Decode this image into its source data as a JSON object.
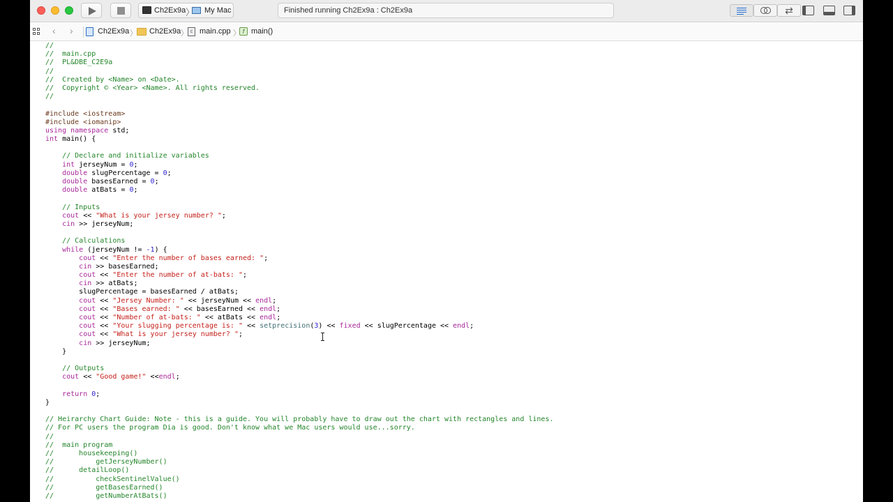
{
  "toolbar": {
    "scheme_target": "Ch2Ex9a",
    "scheme_device": "My Mac",
    "status_text": "Finished running Ch2Ex9a : Ch2Ex9a"
  },
  "jumpbar": {
    "project": "Ch2Ex9a",
    "folder": "Ch2Ex9a",
    "file": "main.cpp",
    "function": "main()",
    "function_icon_glyph": "f",
    "file_icon_glyph": "c"
  },
  "editor": {
    "lines": [
      {
        "segments": [
          {
            "t": "//",
            "c": "cm"
          }
        ]
      },
      {
        "segments": [
          {
            "t": "//  main.cpp",
            "c": "cm"
          }
        ]
      },
      {
        "segments": [
          {
            "t": "//  PL&DBE_C2E9a",
            "c": "cm"
          }
        ]
      },
      {
        "segments": [
          {
            "t": "//",
            "c": "cm"
          }
        ]
      },
      {
        "segments": [
          {
            "t": "//  Created by <Name> on <Date>.",
            "c": "cm"
          }
        ]
      },
      {
        "segments": [
          {
            "t": "//  Copyright © <Year> <Name>. All rights reserved.",
            "c": "cm"
          }
        ]
      },
      {
        "segments": [
          {
            "t": "//",
            "c": "cm"
          }
        ]
      },
      {
        "segments": []
      },
      {
        "segments": [
          {
            "t": "#include <iostream>",
            "c": "pp"
          }
        ]
      },
      {
        "segments": [
          {
            "t": "#include <iomanip>",
            "c": "pp"
          }
        ]
      },
      {
        "segments": [
          {
            "t": "using namespace",
            "c": "kw"
          },
          {
            "t": " std;",
            "c": ""
          }
        ]
      },
      {
        "segments": [
          {
            "t": "int",
            "c": "kw"
          },
          {
            "t": " main() {",
            "c": ""
          }
        ]
      },
      {
        "segments": []
      },
      {
        "segments": [
          {
            "t": "    // Declare and initialize variables",
            "c": "cm"
          }
        ]
      },
      {
        "segments": [
          {
            "t": "    ",
            "c": ""
          },
          {
            "t": "int",
            "c": "kw"
          },
          {
            "t": " jerseyNum = ",
            "c": ""
          },
          {
            "t": "0",
            "c": "nm"
          },
          {
            "t": ";",
            "c": ""
          }
        ]
      },
      {
        "segments": [
          {
            "t": "    ",
            "c": ""
          },
          {
            "t": "double",
            "c": "kw"
          },
          {
            "t": " slugPercentage = ",
            "c": ""
          },
          {
            "t": "0",
            "c": "nm"
          },
          {
            "t": ";",
            "c": ""
          }
        ]
      },
      {
        "segments": [
          {
            "t": "    ",
            "c": ""
          },
          {
            "t": "double",
            "c": "kw"
          },
          {
            "t": " basesEarned = ",
            "c": ""
          },
          {
            "t": "0",
            "c": "nm"
          },
          {
            "t": ";",
            "c": ""
          }
        ]
      },
      {
        "segments": [
          {
            "t": "    ",
            "c": ""
          },
          {
            "t": "double",
            "c": "kw"
          },
          {
            "t": " atBats = ",
            "c": ""
          },
          {
            "t": "0",
            "c": "nm"
          },
          {
            "t": ";",
            "c": ""
          }
        ]
      },
      {
        "segments": []
      },
      {
        "segments": [
          {
            "t": "    // Inputs",
            "c": "cm"
          }
        ]
      },
      {
        "segments": [
          {
            "t": "    ",
            "c": ""
          },
          {
            "t": "cout",
            "c": "kw"
          },
          {
            "t": " << ",
            "c": ""
          },
          {
            "t": "\"What is your jersey number? \"",
            "c": "st"
          },
          {
            "t": ";",
            "c": ""
          }
        ]
      },
      {
        "segments": [
          {
            "t": "    ",
            "c": ""
          },
          {
            "t": "cin",
            "c": "kw"
          },
          {
            "t": " >> jerseyNum;",
            "c": ""
          }
        ]
      },
      {
        "segments": []
      },
      {
        "segments": [
          {
            "t": "    // Calculations",
            "c": "cm"
          }
        ]
      },
      {
        "segments": [
          {
            "t": "    ",
            "c": ""
          },
          {
            "t": "while",
            "c": "kw"
          },
          {
            "t": " (jerseyNum != ",
            "c": ""
          },
          {
            "t": "-1",
            "c": "nm"
          },
          {
            "t": ") {",
            "c": ""
          }
        ]
      },
      {
        "segments": [
          {
            "t": "        ",
            "c": ""
          },
          {
            "t": "cout",
            "c": "kw"
          },
          {
            "t": " << ",
            "c": ""
          },
          {
            "t": "\"Enter the number of bases earned: \"",
            "c": "st"
          },
          {
            "t": ";",
            "c": ""
          }
        ]
      },
      {
        "segments": [
          {
            "t": "        ",
            "c": ""
          },
          {
            "t": "cin",
            "c": "kw"
          },
          {
            "t": " >> basesEarned;",
            "c": ""
          }
        ]
      },
      {
        "segments": [
          {
            "t": "        ",
            "c": ""
          },
          {
            "t": "cout",
            "c": "kw"
          },
          {
            "t": " << ",
            "c": ""
          },
          {
            "t": "\"Enter the number of at-bats: \"",
            "c": "st"
          },
          {
            "t": ";",
            "c": ""
          }
        ]
      },
      {
        "segments": [
          {
            "t": "        ",
            "c": ""
          },
          {
            "t": "cin",
            "c": "kw"
          },
          {
            "t": " >> atBats;",
            "c": ""
          }
        ]
      },
      {
        "segments": [
          {
            "t": "        slugPercentage = basesEarned / atBats;",
            "c": ""
          }
        ]
      },
      {
        "segments": [
          {
            "t": "        ",
            "c": ""
          },
          {
            "t": "cout",
            "c": "kw"
          },
          {
            "t": " << ",
            "c": ""
          },
          {
            "t": "\"Jersey Number: \"",
            "c": "st"
          },
          {
            "t": " << jerseyNum << ",
            "c": ""
          },
          {
            "t": "endl",
            "c": "kw"
          },
          {
            "t": ";",
            "c": ""
          }
        ]
      },
      {
        "segments": [
          {
            "t": "        ",
            "c": ""
          },
          {
            "t": "cout",
            "c": "kw"
          },
          {
            "t": " << ",
            "c": ""
          },
          {
            "t": "\"Bases earned: \"",
            "c": "st"
          },
          {
            "t": " << basesEarned << ",
            "c": ""
          },
          {
            "t": "endl",
            "c": "kw"
          },
          {
            "t": ";",
            "c": ""
          }
        ]
      },
      {
        "segments": [
          {
            "t": "        ",
            "c": ""
          },
          {
            "t": "cout",
            "c": "kw"
          },
          {
            "t": " << ",
            "c": ""
          },
          {
            "t": "\"Number of at-bats: \"",
            "c": "st"
          },
          {
            "t": " << atBats << ",
            "c": ""
          },
          {
            "t": "endl",
            "c": "kw"
          },
          {
            "t": ";",
            "c": ""
          }
        ]
      },
      {
        "segments": [
          {
            "t": "        ",
            "c": ""
          },
          {
            "t": "cout",
            "c": "kw"
          },
          {
            "t": " << ",
            "c": ""
          },
          {
            "t": "\"Your slugging percentage is: \"",
            "c": "st"
          },
          {
            "t": " << ",
            "c": ""
          },
          {
            "t": "setprecision",
            "c": "fn"
          },
          {
            "t": "(",
            "c": ""
          },
          {
            "t": "3",
            "c": "nm"
          },
          {
            "t": ") << ",
            "c": ""
          },
          {
            "t": "fixed",
            "c": "kw"
          },
          {
            "t": " << slugPercentage << ",
            "c": ""
          },
          {
            "t": "endl",
            "c": "kw"
          },
          {
            "t": ";",
            "c": ""
          }
        ]
      },
      {
        "segments": [
          {
            "t": "        ",
            "c": ""
          },
          {
            "t": "cout",
            "c": "kw"
          },
          {
            "t": " << ",
            "c": ""
          },
          {
            "t": "\"What is your jersey number? \"",
            "c": "st"
          },
          {
            "t": ";",
            "c": ""
          }
        ]
      },
      {
        "segments": [
          {
            "t": "        ",
            "c": ""
          },
          {
            "t": "cin",
            "c": "kw"
          },
          {
            "t": " >> jerseyNum;",
            "c": ""
          }
        ]
      },
      {
        "segments": [
          {
            "t": "    }",
            "c": ""
          }
        ]
      },
      {
        "segments": []
      },
      {
        "segments": [
          {
            "t": "    // Outputs",
            "c": "cm"
          }
        ]
      },
      {
        "segments": [
          {
            "t": "    ",
            "c": ""
          },
          {
            "t": "cout",
            "c": "kw"
          },
          {
            "t": " << ",
            "c": ""
          },
          {
            "t": "\"Good game!\"",
            "c": "st"
          },
          {
            "t": " <<",
            "c": ""
          },
          {
            "t": "endl",
            "c": "kw"
          },
          {
            "t": ";",
            "c": ""
          }
        ]
      },
      {
        "segments": []
      },
      {
        "segments": [
          {
            "t": "    ",
            "c": ""
          },
          {
            "t": "return",
            "c": "kw"
          },
          {
            "t": " ",
            "c": ""
          },
          {
            "t": "0",
            "c": "nm"
          },
          {
            "t": ";",
            "c": ""
          }
        ]
      },
      {
        "segments": [
          {
            "t": "}",
            "c": ""
          }
        ]
      },
      {
        "segments": []
      },
      {
        "segments": [
          {
            "t": "// Heirarchy Chart Guide: Note - this is a guide. You will probably have to draw out the chart with rectangles and lines.",
            "c": "cm"
          }
        ]
      },
      {
        "segments": [
          {
            "t": "// For PC users the program Dia is good. Don't know what we Mac users would use...sorry.",
            "c": "cm"
          }
        ]
      },
      {
        "segments": [
          {
            "t": "//",
            "c": "cm"
          }
        ]
      },
      {
        "segments": [
          {
            "t": "//  main program",
            "c": "cm"
          }
        ]
      },
      {
        "segments": [
          {
            "t": "//      housekeeping()",
            "c": "cm"
          }
        ]
      },
      {
        "segments": [
          {
            "t": "//          getJerseyNumber()",
            "c": "cm"
          }
        ]
      },
      {
        "segments": [
          {
            "t": "//      detailLoop()",
            "c": "cm"
          }
        ]
      },
      {
        "segments": [
          {
            "t": "//          checkSentinelValue()",
            "c": "cm"
          }
        ]
      },
      {
        "segments": [
          {
            "t": "//          getBasesEarned()",
            "c": "cm"
          }
        ]
      },
      {
        "segments": [
          {
            "t": "//          getNumberAtBats()",
            "c": "cm"
          }
        ]
      }
    ]
  },
  "colors": {
    "comment": "#23852a",
    "preprocessor": "#6b3a1e",
    "keyword": "#a8279a",
    "string": "#c4201a",
    "number": "#2a1fcf",
    "function_call": "#3e6d74"
  }
}
